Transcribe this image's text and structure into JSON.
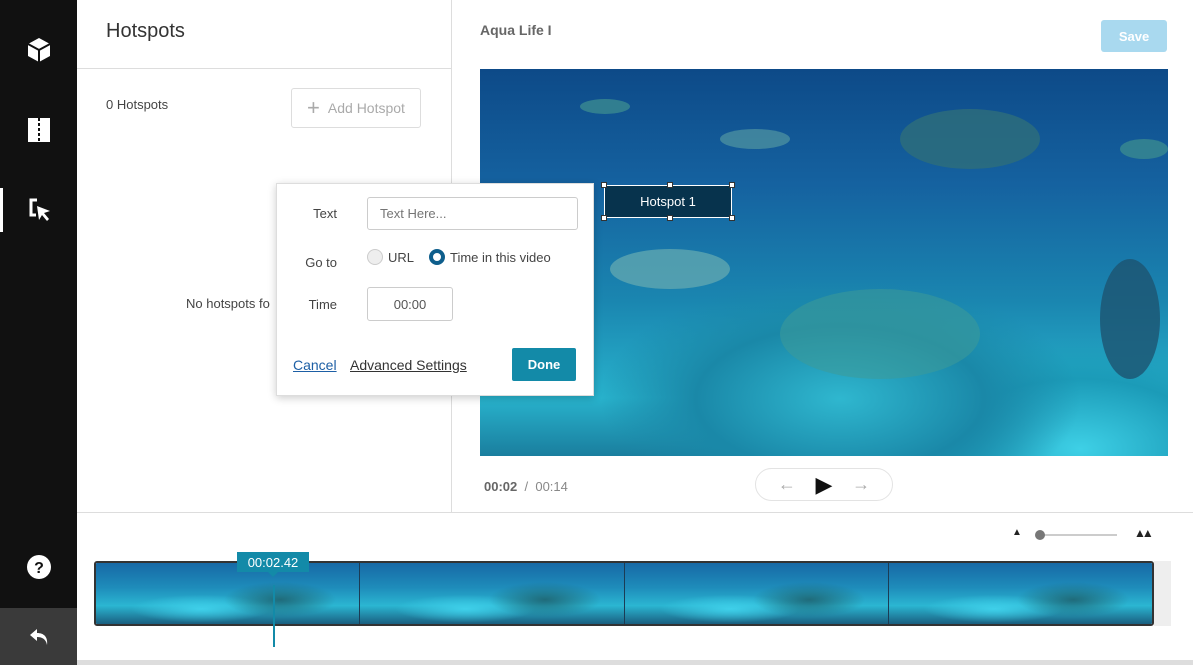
{
  "sidebar": {
    "items": [
      {
        "icon": "cube-icon"
      },
      {
        "icon": "split-icon"
      },
      {
        "icon": "hotspot-cursor-icon",
        "active": true
      }
    ],
    "help_icon": "help-icon",
    "back_icon": "undo-icon"
  },
  "left": {
    "title": "Hotspots",
    "count": "0 Hotspots",
    "add_label": "Add Hotspot",
    "empty": "No hotspots fo"
  },
  "header": {
    "title": "Aqua Life I",
    "save": "Save"
  },
  "hotspot": {
    "label": "Hotspot 1"
  },
  "popup": {
    "text_label": "Text",
    "text_placeholder": "Text Here...",
    "goto_label": "Go to",
    "url_label": "URL",
    "time_option": "Time in this video",
    "time_label": "Time",
    "time_value": "00:00",
    "cancel": "Cancel",
    "advanced": "Advanced Settings",
    "done": "Done"
  },
  "player": {
    "current": "00:02",
    "separator": "/",
    "total": "00:14"
  },
  "timeline": {
    "playhead": "00:02.42",
    "zoom_level": 0
  }
}
